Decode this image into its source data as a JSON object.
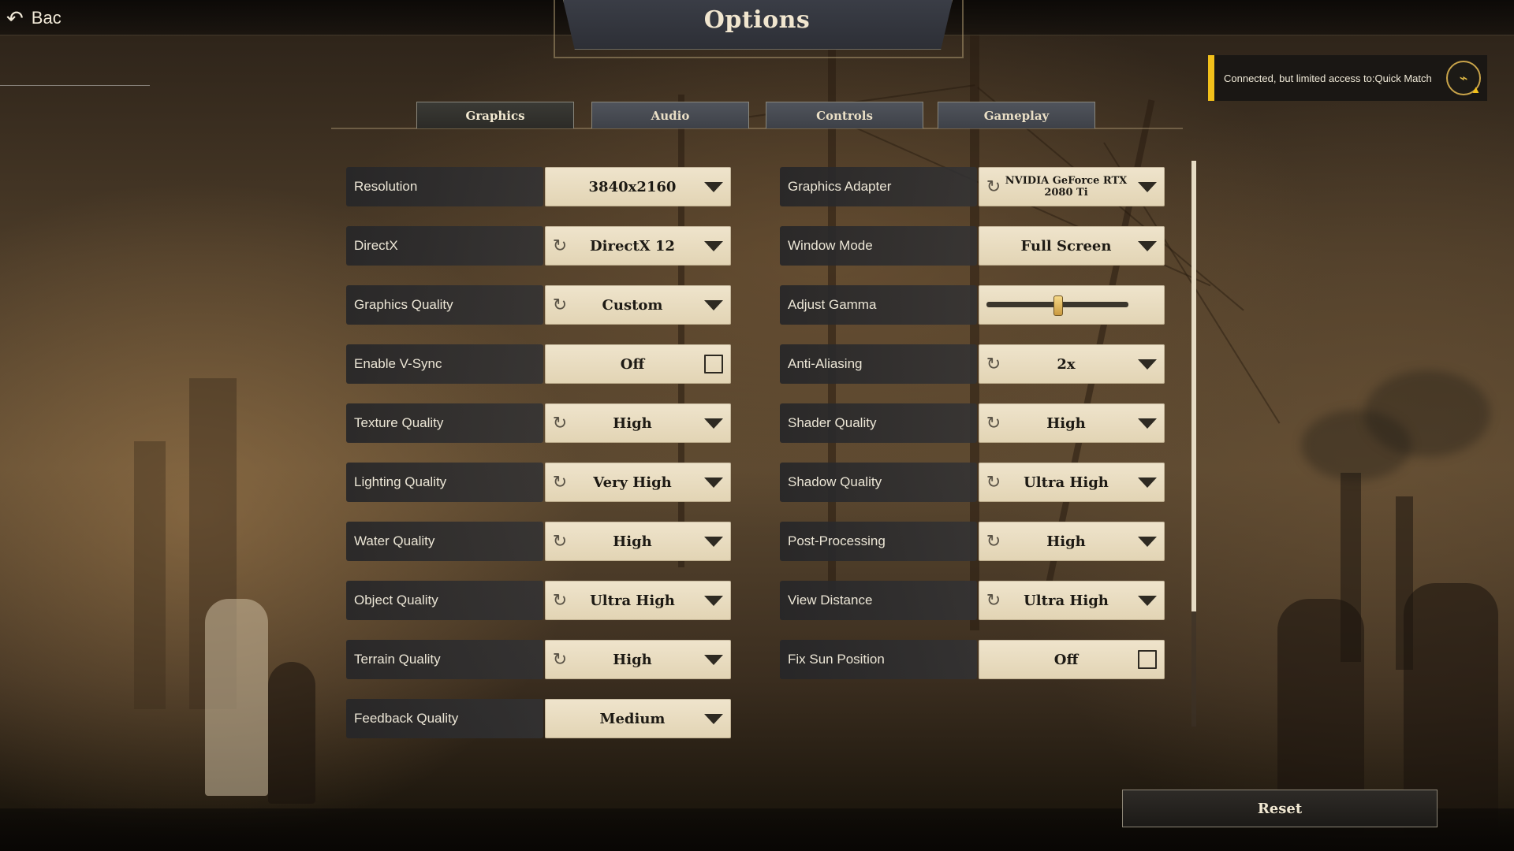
{
  "window": {
    "title": "Options",
    "back_label": "Bac"
  },
  "tabs": [
    {
      "label": "Graphics",
      "active": true
    },
    {
      "label": "Audio",
      "active": false
    },
    {
      "label": "Controls",
      "active": false
    },
    {
      "label": "Gameplay",
      "active": false
    }
  ],
  "notification": {
    "text": "Connected, but limited access to:Quick Match",
    "icon": "network-warning-icon",
    "accent": "#f2c01a"
  },
  "left_settings": [
    {
      "label": "Resolution",
      "value": "3840x2160",
      "type": "dropdown",
      "reset": false
    },
    {
      "label": "DirectX",
      "value": "DirectX 12",
      "type": "dropdown",
      "reset": true
    },
    {
      "label": "Graphics Quality",
      "value": "Custom",
      "type": "dropdown",
      "reset": true
    },
    {
      "label": "Enable V-Sync",
      "value": "Off",
      "type": "checkbox",
      "reset": false
    },
    {
      "label": "Texture Quality",
      "value": "High",
      "type": "dropdown",
      "reset": true
    },
    {
      "label": "Lighting Quality",
      "value": "Very High",
      "type": "dropdown",
      "reset": true
    },
    {
      "label": "Water Quality",
      "value": "High",
      "type": "dropdown",
      "reset": true
    },
    {
      "label": "Object Quality",
      "value": "Ultra High",
      "type": "dropdown",
      "reset": true
    },
    {
      "label": "Terrain Quality",
      "value": "High",
      "type": "dropdown",
      "reset": true
    },
    {
      "label": "Feedback Quality",
      "value": "Medium",
      "type": "dropdown",
      "reset": false
    }
  ],
  "right_settings": [
    {
      "label": "Graphics Adapter",
      "value": "NVIDIA GeForce RTX 2080 Ti",
      "type": "dropdown",
      "reset": true
    },
    {
      "label": "Window Mode",
      "value": "Full Screen",
      "type": "dropdown",
      "reset": false
    },
    {
      "label": "Adjust Gamma",
      "value": "",
      "type": "slider",
      "reset": false,
      "slider_fraction": 0.5
    },
    {
      "label": "Anti-Aliasing",
      "value": "2x",
      "type": "dropdown",
      "reset": true
    },
    {
      "label": "Shader Quality",
      "value": "High",
      "type": "dropdown",
      "reset": true
    },
    {
      "label": "Shadow Quality",
      "value": "Ultra High",
      "type": "dropdown",
      "reset": true
    },
    {
      "label": "Post-Processing",
      "value": "High",
      "type": "dropdown",
      "reset": true
    },
    {
      "label": "View Distance",
      "value": "Ultra High",
      "type": "dropdown",
      "reset": true
    },
    {
      "label": "Fix Sun Position",
      "value": "Off",
      "type": "checkbox",
      "reset": false
    }
  ],
  "footer": {
    "reset_label": "Reset"
  },
  "colors": {
    "control_bg": "#efe4cc",
    "label_bg": "#2a2a2c",
    "tab_bg": "#4a4d55"
  }
}
